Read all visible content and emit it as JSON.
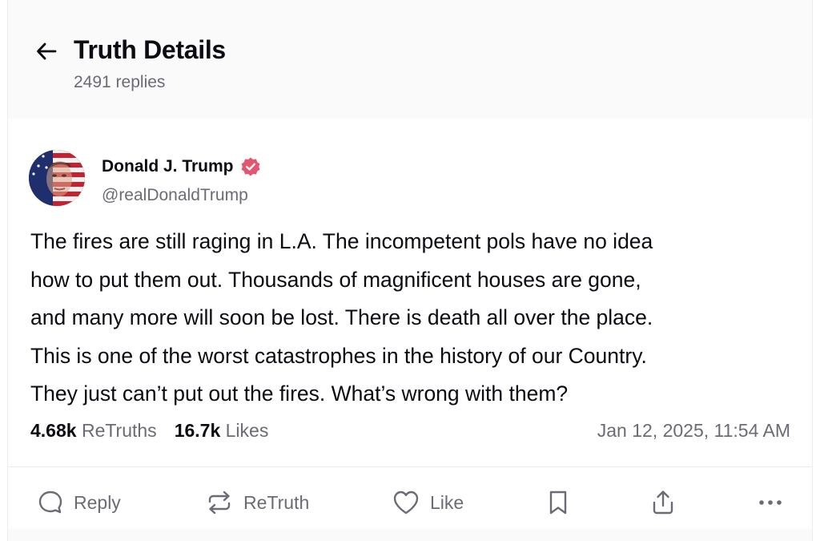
{
  "header": {
    "title": "Truth Details",
    "replies": "2491 replies",
    "back_icon": "arrow-left-icon"
  },
  "post": {
    "author": {
      "name": "Donald J. Trump",
      "handle": "@realDonaldTrump",
      "verified_icon": "verified-badge-icon",
      "verified_color": "#e4566f"
    },
    "text_lines": [
      "The fires are still raging in L.A. The incompetent pols have no idea",
      "how to put them out. Thousands of magnificent houses are gone,",
      "and many more will soon be lost. There is death all over the place.",
      "This is one of the worst catastrophes in the history of our Country.",
      "They just can’t put out the fires. What’s wrong with them?"
    ],
    "stats": {
      "retruths_count": "4.68k",
      "retruths_label": "ReTruths",
      "likes_count": "16.7k",
      "likes_label": "Likes"
    },
    "timestamp": "Jan 12, 2025, 11:54 AM"
  },
  "actions": {
    "reply": {
      "label": "Reply",
      "icon": "speech-bubble-icon"
    },
    "retruth": {
      "label": "ReTruth",
      "icon": "repost-arrows-icon"
    },
    "like": {
      "label": "Like",
      "icon": "heart-icon"
    },
    "bookmark": {
      "icon": "bookmark-icon"
    },
    "share": {
      "icon": "share-upload-icon"
    },
    "more": {
      "icon": "more-dots-icon"
    }
  },
  "colors": {
    "text_primary": "#0b0b12",
    "text_secondary": "#6b6b78",
    "header_bg": "#fafafb",
    "verified": "#e4566f"
  }
}
